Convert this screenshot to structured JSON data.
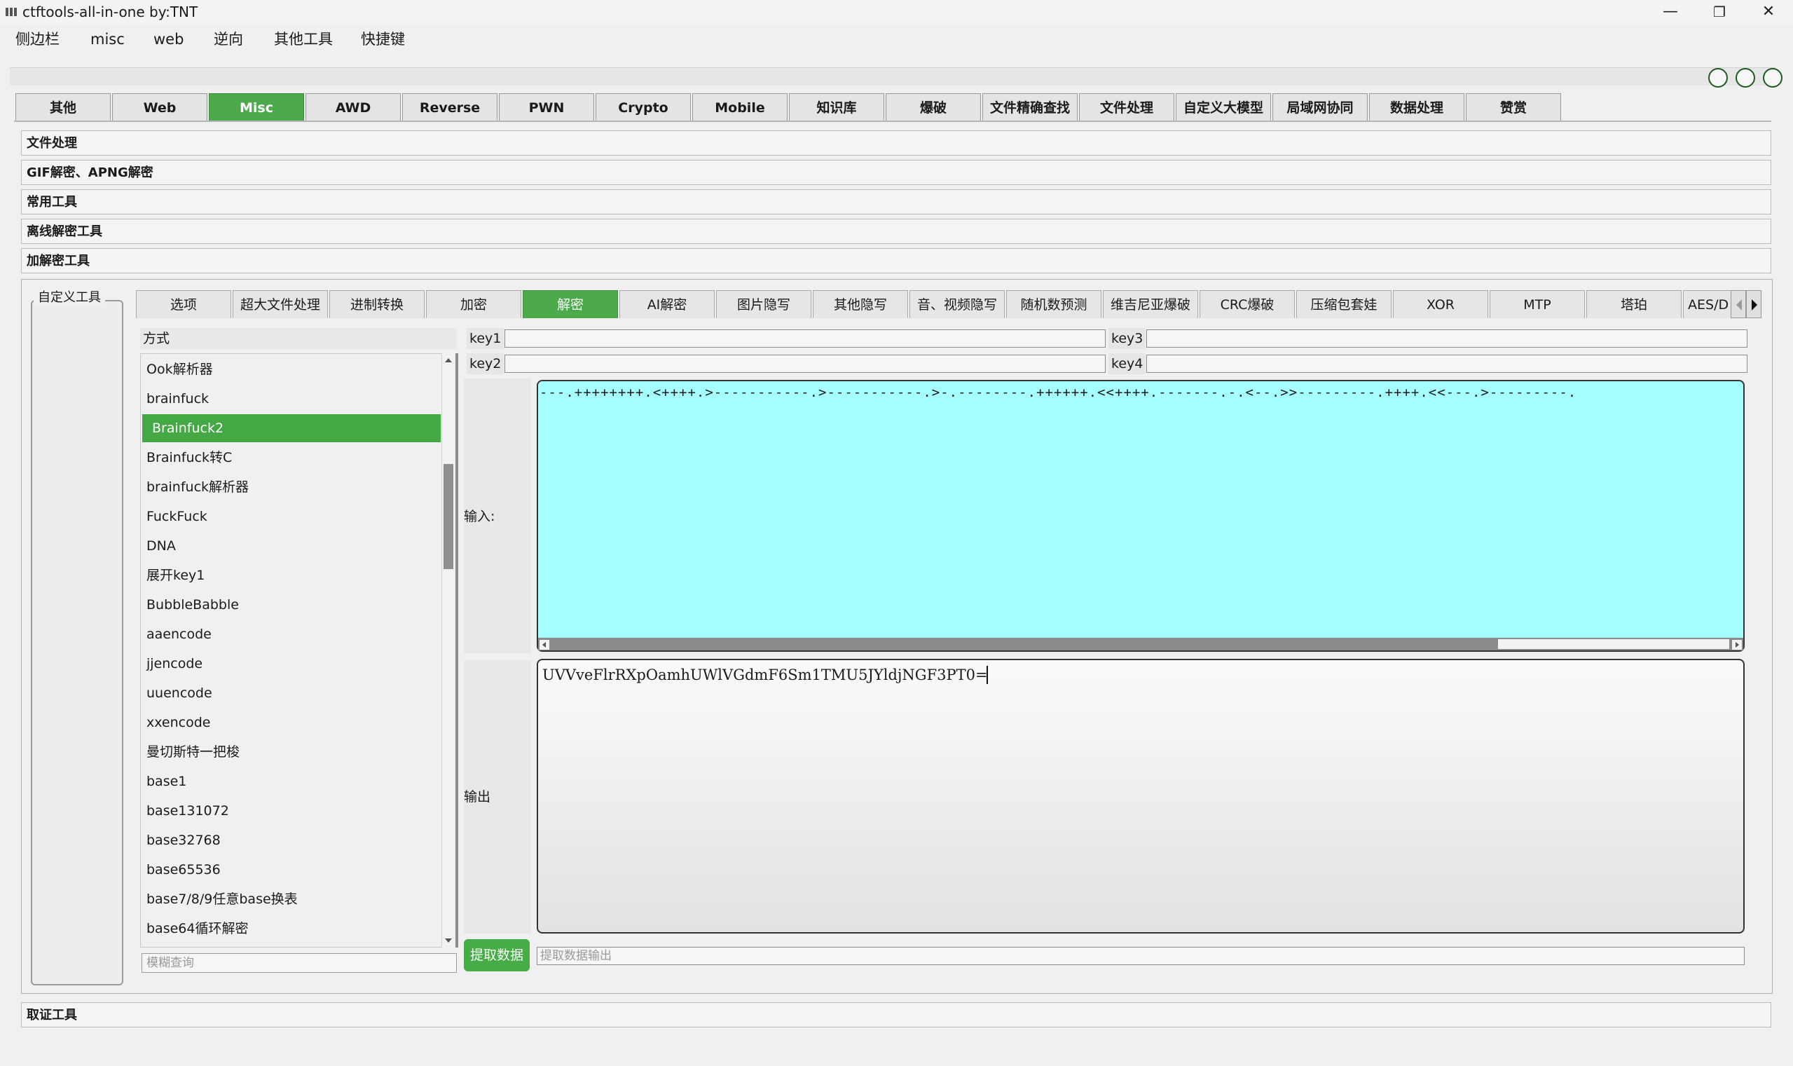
{
  "window": {
    "title": "ctftools-all-in-one   by:TNT",
    "minimize": "—",
    "maximize": "❐",
    "close": "✕"
  },
  "menu": [
    "侧边栏",
    "misc",
    "web",
    "逆向",
    "其他工具",
    "快捷键"
  ],
  "top_tabs": [
    "其他",
    "Web",
    "Misc",
    "AWD",
    "Reverse",
    "PWN",
    "Crypto",
    "Mobile",
    "知识库",
    "爆破",
    "文件精确查找",
    "文件处理",
    "自定义大模型",
    "局域网协同",
    "数据处理",
    "赞赏"
  ],
  "top_tabs_active": "Misc",
  "accordion": [
    "文件处理",
    "GIF解密、APNG解密",
    "常用工具",
    "离线解密工具",
    "加解密工具"
  ],
  "bottom_accordion": "取证工具",
  "custom_tool_label": "自定义工具",
  "sub_tabs": [
    "选项",
    "超大文件处理",
    "进制转换",
    "加密",
    "解密",
    "AI解密",
    "图片隐写",
    "其他隐写",
    "音、视频隐写",
    "随机数预测",
    "维吉尼亚爆破",
    "CRC爆破",
    "压缩包套娃",
    "XOR",
    "MTP",
    "塔珀",
    "AES/D"
  ],
  "sub_tabs_active": "解密",
  "method_header": "方式",
  "methods": [
    "Ook解析器",
    "brainfuck",
    "Brainfuck2",
    "Brainfuck转C",
    "brainfuck解析器",
    "FuckFuck",
    "DNA",
    "展开key1",
    "BubbleBabble",
    "aaencode",
    "jjencode",
    "uuencode",
    "xxencode",
    "曼切斯特一把梭",
    "base1",
    "base131072",
    "base32768",
    "base65536",
    "base7/8/9任意base换表",
    "base64循环解密"
  ],
  "selected_method": "Brainfuck2",
  "search_placeholder": "模糊查询",
  "keys": {
    "key1": "key1",
    "key2": "key2",
    "key3": "key3",
    "key4": "key4"
  },
  "input_label": "输入:",
  "input_text": "---.++++++++.<++++.>-----------.>-----------.>-.--------.++++++.<<++++.-------.-.<--.>>---------.++++.<<---.>---------.",
  "output_label": "输出",
  "output_text": "UVVveFlrRXpOamhUWlVGdmF6Sm1TMU5JYldjNGF3PT0=",
  "extract_button": "提取数据",
  "extract_placeholder": "提取数据输出",
  "accent_color": "#4caa4c",
  "input_bg_color": "#a6ffff"
}
